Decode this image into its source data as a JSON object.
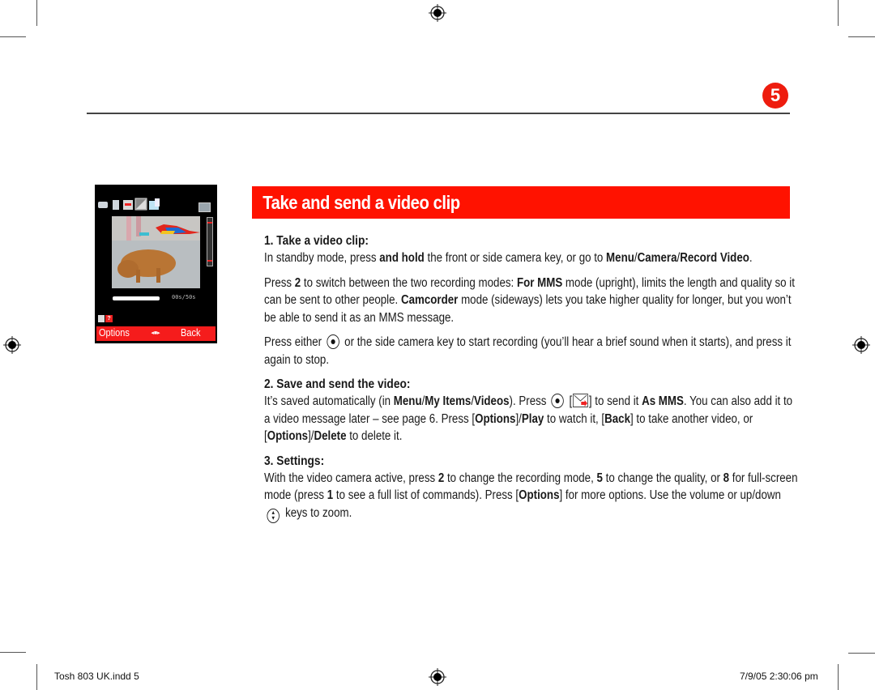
{
  "page": {
    "number": "5",
    "section_title": "Take and send a video clip",
    "accent_color": "#ff1200"
  },
  "phone_screen": {
    "timer_text": "00s/50s",
    "softkey_left": "Options",
    "softkey_right": "Back",
    "icons": [
      "video-mode-icon",
      "quality-icon",
      "record-mode-icon",
      "brightness-icon",
      "folder-icon",
      "zoom-icon"
    ]
  },
  "sections": [
    {
      "heading": "1. Take a video clip:",
      "paragraphs": [
        [
          {
            "t": "In standby mode, press "
          },
          {
            "t": "and hold",
            "b": true
          },
          {
            "t": " the front or side camera key, or go to "
          },
          {
            "t": "Menu",
            "b": true
          },
          {
            "t": "/"
          },
          {
            "t": "Camera",
            "b": true
          },
          {
            "t": "/"
          },
          {
            "t": "Record Video",
            "b": true
          },
          {
            "t": "."
          }
        ],
        [
          {
            "t": "Press "
          },
          {
            "t": "2",
            "b": true
          },
          {
            "t": " to switch between the two recording modes: "
          },
          {
            "t": "For MMS",
            "b": true
          },
          {
            "t": " mode (upright), limits the length and quality so it can be sent to other people. "
          },
          {
            "t": "Camcorder",
            "b": true
          },
          {
            "t": " mode (sideways) lets you take higher quality for longer, but you won’t be able to send it as an MMS message."
          }
        ],
        [
          {
            "t": "Press either "
          },
          {
            "icon": "center-key-icon"
          },
          {
            "t": " or the side camera key to start recording (you’ll hear a brief sound when it starts), and press it again to stop."
          }
        ]
      ]
    },
    {
      "heading": "2. Save and send the video:",
      "paragraphs": [
        [
          {
            "t": "It’s saved automatically (in "
          },
          {
            "t": "Menu",
            "b": true
          },
          {
            "t": "/"
          },
          {
            "t": "My Items",
            "b": true
          },
          {
            "t": "/"
          },
          {
            "t": "Videos",
            "b": true
          },
          {
            "t": "). Press "
          },
          {
            "icon": "center-key-icon"
          },
          {
            "t": " ["
          },
          {
            "icon": "send-mail-icon"
          },
          {
            "t": "] to send it "
          },
          {
            "t": "As MMS",
            "b": true
          },
          {
            "t": ". You can also add it to a video message later – see page 6. Press ["
          },
          {
            "t": "Options",
            "b": true
          },
          {
            "t": "]/"
          },
          {
            "t": "Play",
            "b": true
          },
          {
            "t": " to watch it, ["
          },
          {
            "t": "Back",
            "b": true
          },
          {
            "t": "] to take another video, or ["
          },
          {
            "t": "Options",
            "b": true
          },
          {
            "t": "]/"
          },
          {
            "t": "Delete",
            "b": true
          },
          {
            "t": " to delete it."
          }
        ]
      ]
    },
    {
      "heading": "3. Settings:",
      "paragraphs": [
        [
          {
            "t": "With the video camera active, press "
          },
          {
            "t": "2",
            "b": true
          },
          {
            "t": " to change the recording mode, "
          },
          {
            "t": "5",
            "b": true
          },
          {
            "t": " to change the quality, or "
          },
          {
            "t": "8",
            "b": true
          },
          {
            "t": " for full-screen mode (press "
          },
          {
            "t": "1",
            "b": true
          },
          {
            "t": " to see a full list of commands). Press ["
          },
          {
            "t": "Options",
            "b": true
          },
          {
            "t": "] for more options. Use the volume or up/down "
          },
          {
            "icon": "up-down-key-icon"
          },
          {
            "t": " keys to zoom."
          }
        ]
      ]
    }
  ],
  "footer": {
    "left": "Tosh 803 UK.indd   5",
    "right": "7/9/05   2:30:06 pm"
  }
}
